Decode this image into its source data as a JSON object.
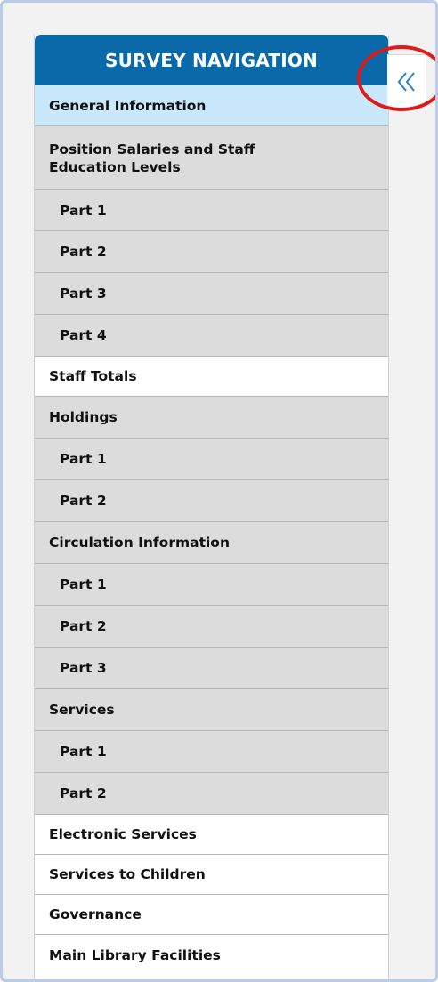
{
  "panel": {
    "header_title": "SURVEY NAVIGATION"
  },
  "nav": {
    "items": [
      {
        "label": "General Information",
        "kind": "section",
        "state": "active"
      },
      {
        "label": "Position Salaries and Staff Education Levels",
        "kind": "section",
        "state": "grey"
      },
      {
        "label": "Part 1",
        "kind": "sub",
        "state": "grey"
      },
      {
        "label": "Part 2",
        "kind": "sub",
        "state": "grey"
      },
      {
        "label": "Part 3",
        "kind": "sub",
        "state": "grey"
      },
      {
        "label": "Part 4",
        "kind": "sub",
        "state": "grey"
      },
      {
        "label": "Staff Totals",
        "kind": "section",
        "state": "white"
      },
      {
        "label": "Holdings",
        "kind": "section",
        "state": "grey"
      },
      {
        "label": "Part 1",
        "kind": "sub",
        "state": "grey"
      },
      {
        "label": "Part 2",
        "kind": "sub",
        "state": "grey"
      },
      {
        "label": "Circulation Information",
        "kind": "section",
        "state": "grey"
      },
      {
        "label": "Part 1",
        "kind": "sub",
        "state": "grey"
      },
      {
        "label": "Part 2",
        "kind": "sub",
        "state": "grey"
      },
      {
        "label": "Part 3",
        "kind": "sub",
        "state": "grey"
      },
      {
        "label": "Services",
        "kind": "section",
        "state": "grey"
      },
      {
        "label": "Part 1",
        "kind": "sub",
        "state": "grey"
      },
      {
        "label": "Part 2",
        "kind": "sub",
        "state": "grey"
      },
      {
        "label": "Electronic Services",
        "kind": "section",
        "state": "white"
      },
      {
        "label": "Services to Children",
        "kind": "section",
        "state": "white"
      },
      {
        "label": "Governance",
        "kind": "section",
        "state": "white"
      },
      {
        "label": "Main Library Facilities",
        "kind": "section",
        "state": "white"
      }
    ]
  },
  "collapse_button": {
    "icon": "double-chevron-left-icon"
  },
  "colors": {
    "header_bg": "#0a6aa9",
    "active_bg": "#c9e8fb",
    "inactive_bg": "#dcdcdc",
    "chevron": "#2b7fc3",
    "annotation_circle": "#e01919"
  }
}
